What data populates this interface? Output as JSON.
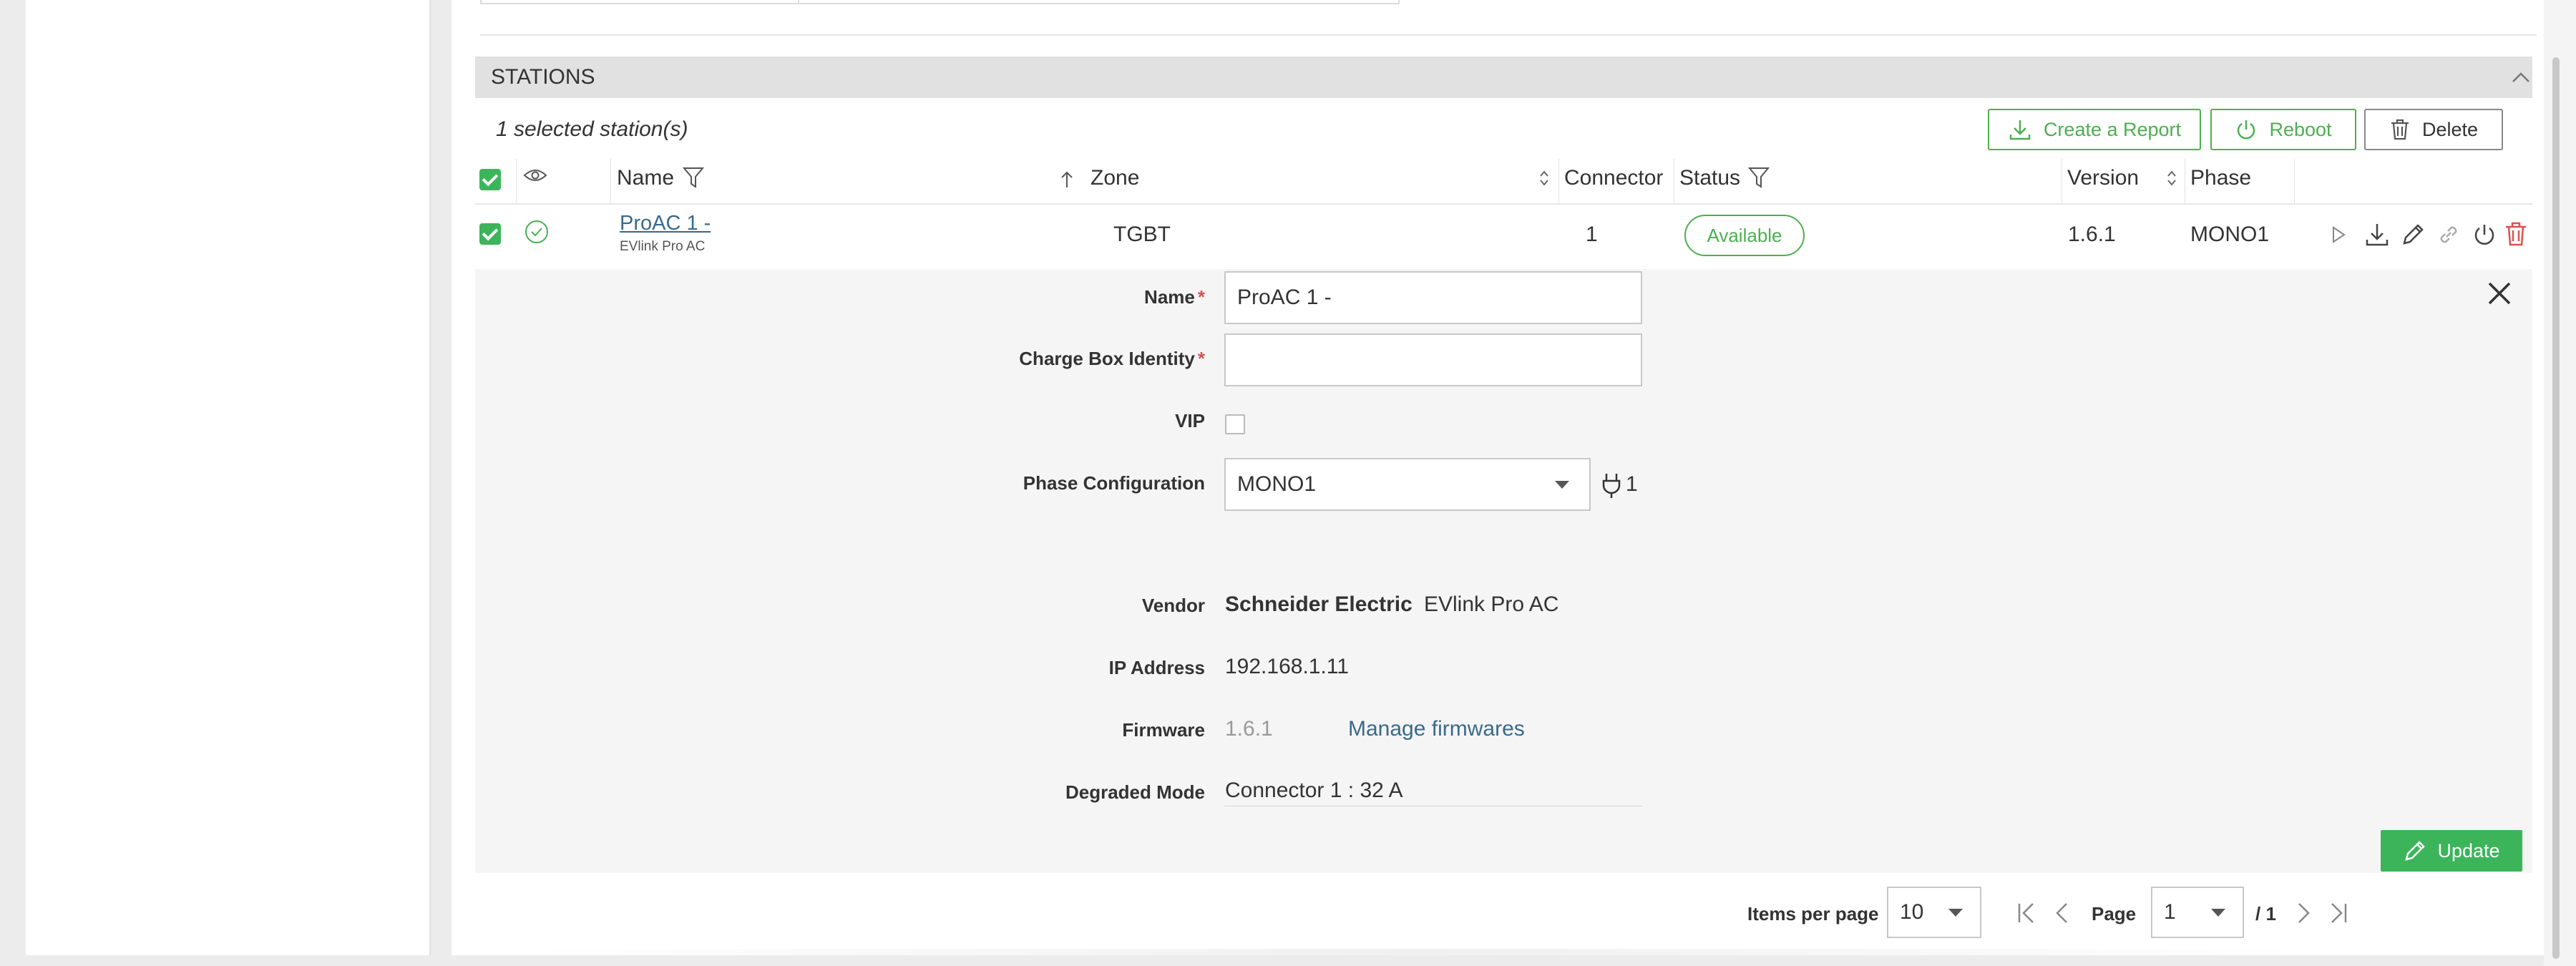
{
  "stations_panel": {
    "title": "STATIONS",
    "selected_count_text": "1 selected station(s)",
    "actions": {
      "create_report": "Create a Report",
      "reboot": "Reboot",
      "delete": "Delete"
    }
  },
  "table": {
    "columns": {
      "name": "Name",
      "zone": "Zone",
      "connector": "Connector",
      "status": "Status",
      "version": "Version",
      "phase": "Phase"
    },
    "rows": [
      {
        "name": "ProAC 1 -",
        "model": "EVlink Pro AC",
        "zone": "TGBT",
        "connector": "1",
        "status": "Available",
        "version": "1.6.1",
        "phase": "MONO1"
      }
    ]
  },
  "detail_form": {
    "name_label": "Name",
    "name_value": "ProAC 1 -",
    "charge_box_identity_label": "Charge Box Identity",
    "charge_box_identity_value": "",
    "required_marker": "*",
    "vip_label": "VIP",
    "vip_checked": false,
    "phase_configuration_label": "Phase Configuration",
    "phase_configuration_value": "MONO1",
    "phase_connector_count": "1",
    "vendor_label": "Vendor",
    "vendor_brand": "Schneider Electric",
    "vendor_model": "EVlink Pro AC",
    "ip_address_label": "IP Address",
    "ip_address_value": "192.168.1.11",
    "firmware_label": "Firmware",
    "firmware_value": "1.6.1",
    "manage_firmwares_link": "Manage firmwares",
    "degraded_mode_label": "Degraded Mode",
    "degraded_mode_value": "Connector 1 : 32 A",
    "update_button": "Update"
  },
  "pagination": {
    "items_per_page_label": "Items per page",
    "items_per_page_value": "10",
    "page_label": "Page",
    "page_value": "1",
    "total_pages_text": "/ 1"
  },
  "colors": {
    "accent_green": "#4caf50",
    "update_green": "#3cb55a",
    "delete_red": "#d9534f",
    "link_blue": "#3a6a8a"
  }
}
